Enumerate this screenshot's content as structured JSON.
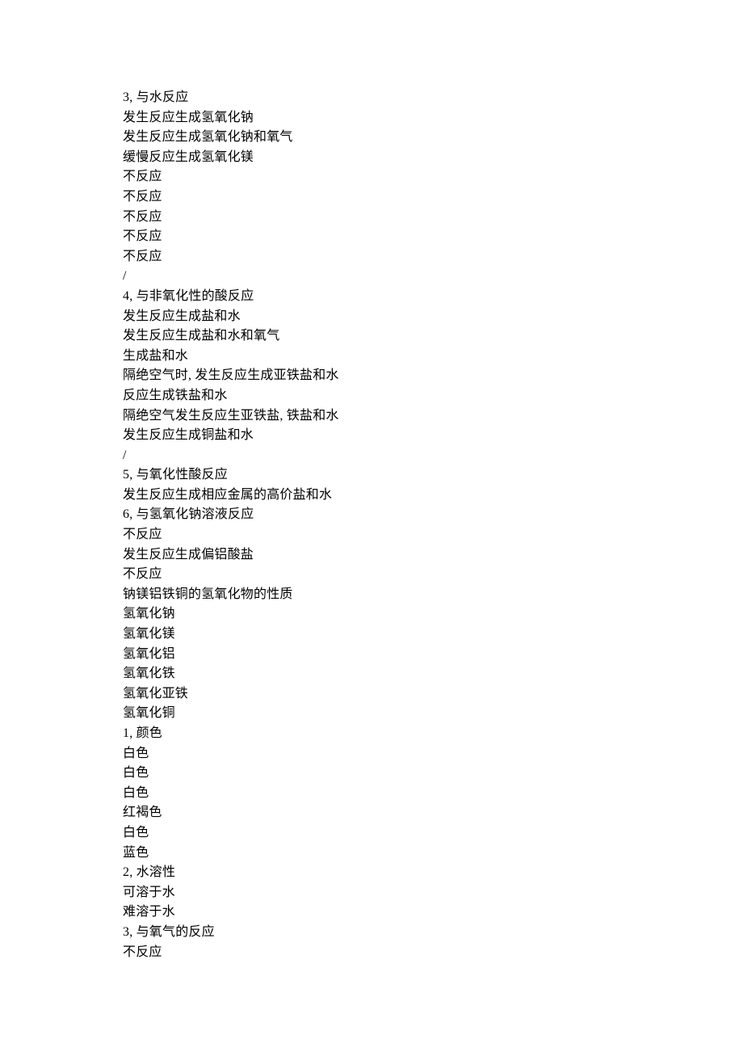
{
  "lines": [
    "3, 与水反应",
    "发生反应生成氢氧化钠",
    "发生反应生成氢氧化钠和氧气",
    "缓慢反应生成氢氧化镁",
    "不反应",
    "不反应",
    "不反应",
    "不反应",
    "不反应",
    "/",
    "4, 与非氧化性的酸反应",
    "发生反应生成盐和水",
    "发生反应生成盐和水和氧气",
    "生成盐和水",
    "隔绝空气时, 发生反应生成亚铁盐和水",
    "反应生成铁盐和水",
    "隔绝空气发生反应生亚铁盐, 铁盐和水",
    "发生反应生成铜盐和水",
    "/",
    "5, 与氧化性酸反应",
    "发生反应生成相应金属的高价盐和水",
    "6, 与氢氧化钠溶液反应",
    "不反应",
    "发生反应生成偏铝酸盐",
    "不反应",
    "钠镁铝铁铜的氢氧化物的性质",
    "氢氧化钠",
    "氢氧化镁",
    "氢氧化铝",
    "氢氧化铁",
    "氢氧化亚铁",
    "氢氧化铜",
    "1, 颜色",
    "白色",
    "白色",
    "白色",
    "红褐色",
    "白色",
    "蓝色",
    "2, 水溶性",
    "可溶于水",
    "难溶于水",
    "3, 与氧气的反应",
    "不反应"
  ]
}
